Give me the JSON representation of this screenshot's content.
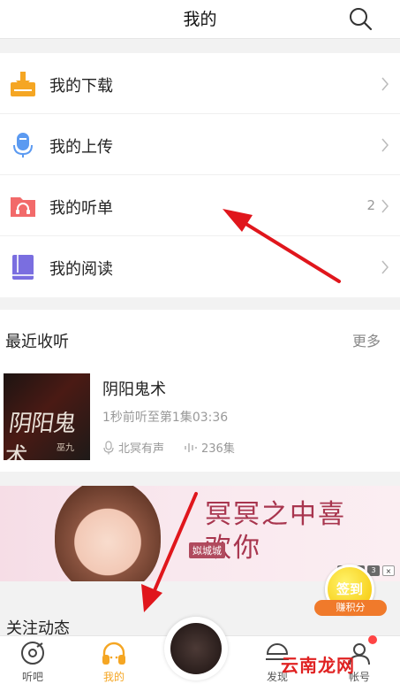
{
  "header": {
    "title": "我的"
  },
  "menu": [
    {
      "label": "我的下载",
      "icon": "download-icon",
      "count": ""
    },
    {
      "label": "我的上传",
      "icon": "upload-icon",
      "count": ""
    },
    {
      "label": "我的听单",
      "icon": "playlist-icon",
      "count": "2"
    },
    {
      "label": "我的阅读",
      "icon": "book-icon",
      "count": ""
    }
  ],
  "recent": {
    "title": "最近收听",
    "more": "更多",
    "item": {
      "title": "阴阳鬼术",
      "progress": "1秒前听至第1集03:36",
      "author": "北冥有声",
      "episodes": "236集",
      "cover_text": "阴阳鬼术",
      "cover_sub": "巫九"
    }
  },
  "banner": {
    "headline": "冥冥之中喜欢你",
    "tag": "姒城城",
    "dots": [
      "",
      "",
      "3",
      "×"
    ]
  },
  "sign": {
    "label": "签到",
    "sub": "赚积分"
  },
  "follow": {
    "title": "关注动态"
  },
  "tabs": [
    {
      "label": "听吧",
      "icon": "disc-icon",
      "active": false
    },
    {
      "label": "我的",
      "icon": "headphones-icon",
      "active": true
    },
    {
      "label": "发现",
      "icon": "discover-icon",
      "active": false
    },
    {
      "label": "帐号",
      "icon": "account-icon",
      "active": false
    }
  ],
  "watermark": "云南龙网",
  "colors": {
    "accent": "#f5a623",
    "arrow": "#e0161c",
    "download": "#f5a623",
    "upload": "#5b9af1",
    "playlist": "#f26a6a",
    "book": "#7a6ee0"
  }
}
